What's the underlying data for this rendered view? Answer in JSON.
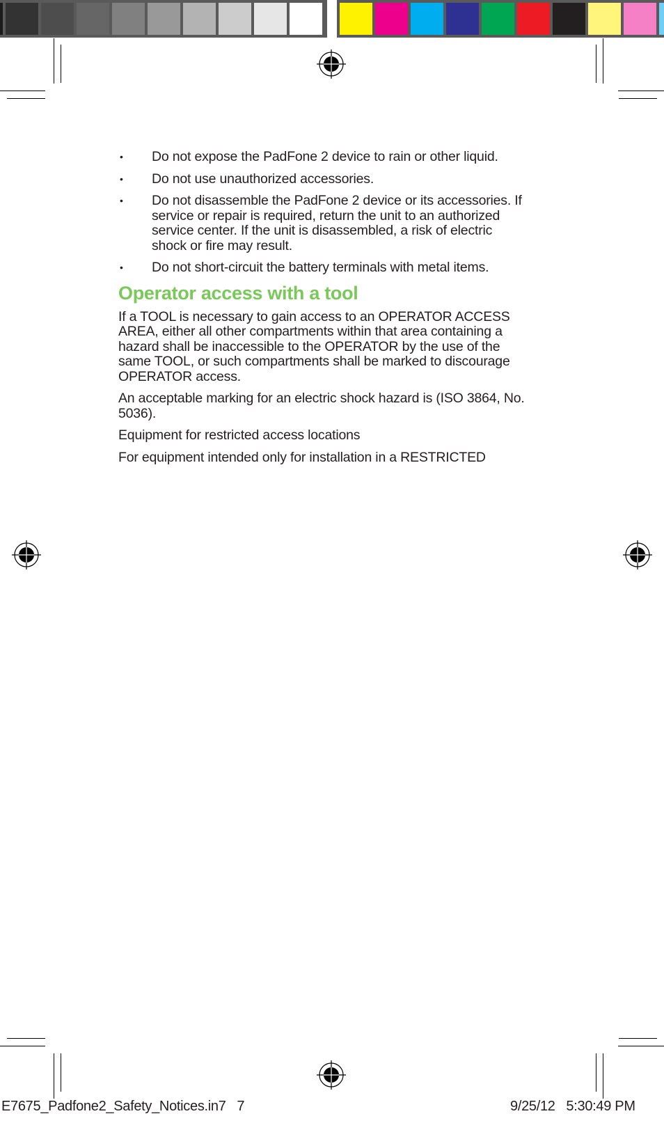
{
  "color_bars": {
    "grayscale": [
      "#1c1c1c",
      "#333333",
      "#4d4d4d",
      "#666666",
      "#808080",
      "#999999",
      "#b3b3b3",
      "#cccccc",
      "#e6e6e6",
      "#ffffff"
    ],
    "process": [
      "#fff200",
      "#ec008c",
      "#00aeef",
      "#2e3192",
      "#00a651",
      "#ed1c24",
      "#231f20",
      "#fff57d",
      "#f580c6",
      "#6dcff6"
    ]
  },
  "bullets": [
    {
      "prefix": "Do not expose the ",
      "emphasis": "PadFone 2 device to rain or other liquid.",
      "rest": ""
    },
    {
      "prefix": "Do not use unauthorized accessories.",
      "emphasis": "",
      "rest": ""
    },
    {
      "prefix": "Do not disassemble the ",
      "emphasis": "PadFone 2 device or its accessories.",
      "rest": " If service or repair is required, return the unit to an authorized service center. If the unit is disassembled, a risk of electric shock or fire may result."
    },
    {
      "prefix": "Do not short-circuit the battery terminals with metal items.",
      "emphasis": "",
      "rest": ""
    }
  ],
  "bullet_symbol": "•",
  "heading": "Operator access with a tool",
  "heading_color": "#7ac75a",
  "paragraphs": [
    "If a TOOL is necessary to gain access to an OPERATOR ACCESS AREA, either all other compartments within that area containing a hazard shall be inaccessible to the OPERATOR by the use of the same TOOL, or such compartments shall be marked to discourage OPERATOR access.",
    "An acceptable marking for an electric shock hazard is (ISO 3864, No. 5036).",
    "Equipment for restricted access locations",
    "For equipment intended only for installation in a RESTRICTED"
  ],
  "footer": {
    "file_name": "E7675_Padfone2_Safety_Notices.in7",
    "page": "7",
    "date": "9/25/12",
    "time": "5:30:49 PM"
  }
}
